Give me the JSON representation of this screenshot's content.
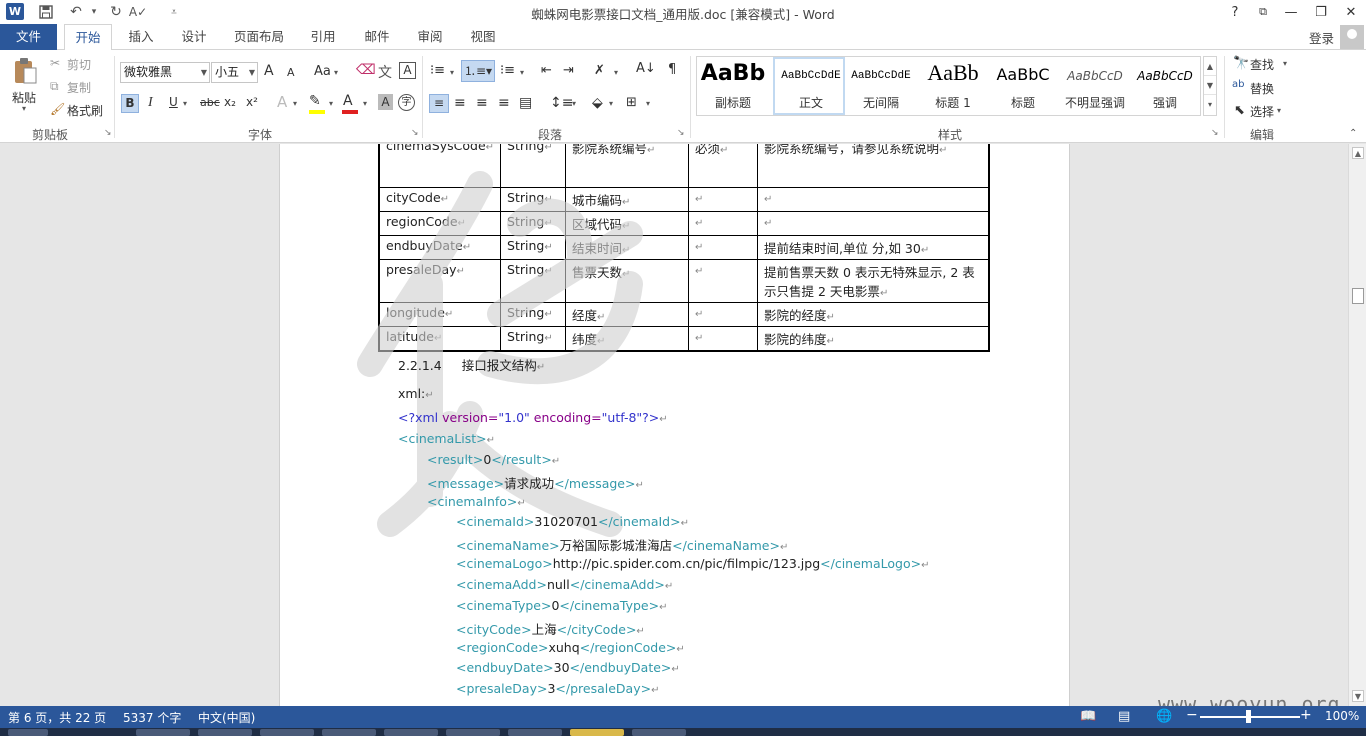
{
  "title_bar": {
    "title": "蜘蛛网电影票接口文档_通用版.doc [兼容模式] - Word",
    "help": "?",
    "restore_ribbon": "⧉",
    "minimize": "—",
    "maximize": "❐",
    "close": "✕"
  },
  "tabs": {
    "file": "文件",
    "items": [
      "开始",
      "插入",
      "设计",
      "页面布局",
      "引用",
      "邮件",
      "审阅",
      "视图"
    ],
    "login": "登录"
  },
  "clipboard": {
    "paste": "粘贴",
    "cut": "剪切",
    "copy": "复制",
    "format_painter": "格式刷",
    "group": "剪贴板"
  },
  "font": {
    "name": "微软雅黑",
    "size": "小五",
    "group": "字体",
    "change_case": "Aa",
    "bold": "B",
    "italic": "I",
    "underline": "U",
    "strike": "abc",
    "sub": "x₂",
    "sup": "x²",
    "grow": "A",
    "shrink": "A",
    "char_shading": "A",
    "enclose": "字"
  },
  "paragraph": {
    "group": "段落"
  },
  "styles": {
    "group": "样式",
    "items": [
      {
        "preview": "AaBb",
        "name": "副标题"
      },
      {
        "preview": "AaBbCcDdE",
        "name": "正文"
      },
      {
        "preview": "AaBbCcDdE",
        "name": "无间隔"
      },
      {
        "preview": "AaBb",
        "name": "标题 1"
      },
      {
        "preview": "AaBbC",
        "name": "标题"
      },
      {
        "preview": "AaBbCcD",
        "name": "不明显强调"
      },
      {
        "preview": "AaBbCcD",
        "name": "强调"
      }
    ]
  },
  "editing": {
    "group": "编辑",
    "find": "查找",
    "replace": "替换",
    "select": "选择"
  },
  "table": {
    "rows": [
      [
        "cinemaSysCode",
        "String",
        "影院系统编号",
        "必须",
        "影院系统编号，请参见系统说明"
      ],
      [
        "cityCode",
        "String",
        "城市编码",
        "",
        ""
      ],
      [
        "regionCode",
        "String",
        "区域代码",
        "",
        ""
      ],
      [
        "endbuyDate",
        "String",
        "结束时间",
        "",
        "提前结束时间,单位 分,如 30"
      ],
      [
        "presaleDay",
        "String",
        "售票天数",
        "",
        "提前售票天数  0 表示无特殊显示, 2 表示只售提 2 天电影票"
      ],
      [
        "longitude",
        "String",
        "经度",
        "",
        "影院的经度"
      ],
      [
        "latitude",
        "String",
        "纬度",
        "",
        "影院的纬度"
      ]
    ]
  },
  "doc": {
    "heading_num": "2.2.1.4",
    "heading_text": "接口报文结构",
    "xml_label": "xml:",
    "decl": {
      "open": "<?xml ",
      "version_attr": "version=",
      "version_val": "\"1.0\"",
      "encoding_attr": " encoding=",
      "encoding_val": "\"utf-8\"",
      "close": "?>"
    },
    "lines": [
      {
        "indent": 0,
        "open": "<cinemaList>",
        "value": "",
        "close": ""
      },
      {
        "indent": 1,
        "open": "<result>",
        "value": "0",
        "close": "</result>"
      },
      {
        "indent": 1,
        "open": "<message>",
        "value": "请求成功",
        "close": "</message>"
      },
      {
        "indent": 1,
        "open": "<cinemaInfo>",
        "value": "",
        "close": ""
      },
      {
        "indent": 2,
        "open": "<cinemaId>",
        "value": "31020701",
        "close": "</cinemaId>"
      },
      {
        "indent": 2,
        "open": "<cinemaName>",
        "value": "万裕国际影城淮海店",
        "close": "</cinemaName>"
      },
      {
        "indent": 2,
        "open": "<cinemaLogo>",
        "value": "http://pic.spider.com.cn/pic/filmpic/123.jpg",
        "close": "</cinemaLogo>"
      },
      {
        "indent": 2,
        "open": "<cinemaAdd>",
        "value": "null",
        "close": "</cinemaAdd>"
      },
      {
        "indent": 2,
        "open": "<cinemaType>",
        "value": "0",
        "close": "</cinemaType>"
      },
      {
        "indent": 2,
        "open": "<cityCode>",
        "value": "上海",
        "close": "</cityCode>"
      },
      {
        "indent": 2,
        "open": "<regionCode>",
        "value": "xuhq",
        "close": "</regionCode>"
      },
      {
        "indent": 2,
        "open": "<endbuyDate>",
        "value": "30",
        "close": "</endbuyDate>"
      },
      {
        "indent": 2,
        "open": "<presaleDay>",
        "value": "3",
        "close": "</presaleDay>"
      }
    ]
  },
  "status": {
    "page": "第 6 页，共 22 页",
    "words": "5337 个字",
    "lang": "中文(中国)",
    "zoom": "100%"
  },
  "watermark_site": "www.wooyun.org",
  "colors": {
    "accent": "#2b579a",
    "xml_tag": "#3399aa",
    "xml_decl": "#3333cc"
  }
}
